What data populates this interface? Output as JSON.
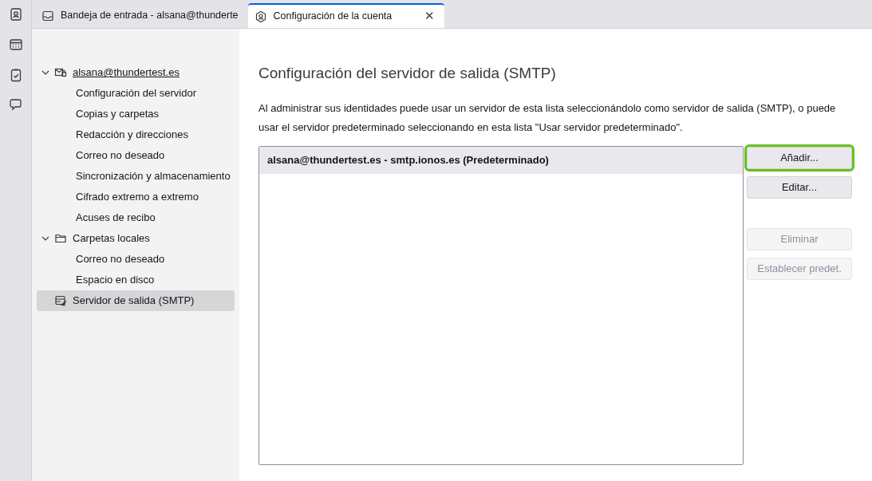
{
  "tabs": [
    {
      "label": "Bandeja de entrada - alsana@thunderte",
      "selected": false
    },
    {
      "label": "Configuración de la cuenta",
      "selected": true,
      "close": "✕"
    }
  ],
  "sidebar": {
    "items": [
      {
        "label": "alsana@thundertest.es",
        "expanded": true,
        "selected": false,
        "children": [
          {
            "label": "Configuración del servidor",
            "selected": false
          },
          {
            "label": "Copias y carpetas",
            "selected": false
          },
          {
            "label": "Redacción y direcciones",
            "selected": false
          },
          {
            "label": "Correo no deseado",
            "selected": false
          },
          {
            "label": "Sincronización y almacenamiento",
            "selected": false
          },
          {
            "label": "Cifrado extremo a extremo",
            "selected": false
          },
          {
            "label": "Acuses de recibo",
            "selected": false
          }
        ]
      },
      {
        "label": "Carpetas locales",
        "expanded": true,
        "selected": false,
        "children": [
          {
            "label": "Correo no deseado",
            "selected": false
          },
          {
            "label": "Espacio en disco",
            "selected": false
          }
        ]
      },
      {
        "label": "Servidor de salida (SMTP)",
        "selected": true
      }
    ]
  },
  "main": {
    "title": "Configuración del servidor de salida (SMTP)",
    "description": "Al administrar sus identidades puede usar un servidor de esta lista seleccionándolo como servidor de salida (SMTP), o puede usar el servidor predeterminado seleccionando en esta lista \"Usar servidor predeterminado\".",
    "servers": [
      {
        "label": "alsana@thundertest.es - smtp.ionos.es (Predeterminado)",
        "selected": true
      }
    ],
    "buttons": [
      {
        "label": "Añadir...",
        "disabled": false,
        "highlighted": true
      },
      {
        "label": "Editar...",
        "disabled": false,
        "highlighted": false
      },
      {
        "label": "Eliminar",
        "disabled": true,
        "highlighted": false
      },
      {
        "label": "Establecer predet.",
        "disabled": true,
        "highlighted": false
      }
    ]
  }
}
